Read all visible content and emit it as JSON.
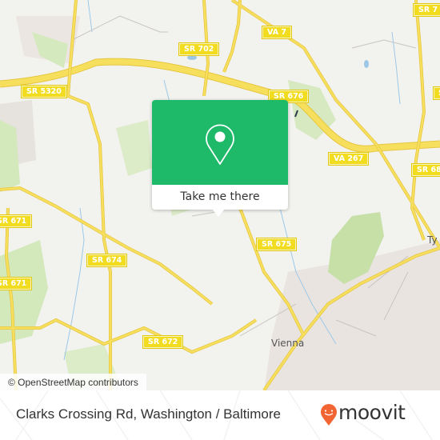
{
  "map": {
    "road_shields": [
      {
        "label": "VA 7"
      },
      {
        "label": "SR 7"
      },
      {
        "label": "SR 702"
      },
      {
        "label": "SR 5320"
      },
      {
        "label": "SR 676"
      },
      {
        "label": "VA 267"
      },
      {
        "label": "SR 68"
      },
      {
        "label": "SR 671"
      },
      {
        "label": "SR 671"
      },
      {
        "label": "SR 674"
      },
      {
        "label": "SR 675"
      },
      {
        "label": "SR 672"
      },
      {
        "label": "SR"
      }
    ],
    "places": [
      {
        "label": "Vienna"
      },
      {
        "label": "Ty"
      }
    ],
    "attribution": "© OpenStreetMap contributors",
    "colors": {
      "background": "#f2f2ef",
      "road": "#f5d94a",
      "park": "#d4e8b8",
      "water": "#9cc8e8",
      "urban": "#e8e2de"
    }
  },
  "popup": {
    "icon": "location-pin-icon",
    "action_label": "Take me there",
    "color": "#1fb96a"
  },
  "footer": {
    "title": "Clarks Crossing Rd, Washington / Baltimore",
    "brand": "moovit",
    "brand_color": "#f26532"
  }
}
